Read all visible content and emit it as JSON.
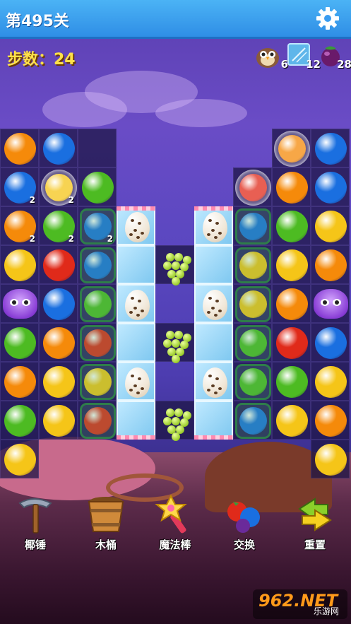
{
  "header": {
    "level_title": "第495关",
    "settings_icon": "gear-icon"
  },
  "moves": {
    "label": "步数：24"
  },
  "goals": [
    {
      "icon": "owl-monster-icon",
      "count": "6"
    },
    {
      "icon": "ice-block-icon",
      "count": "12"
    },
    {
      "icon": "mangosteen-icon",
      "count": "28"
    }
  ],
  "colors": {
    "orange": "#f58a0a",
    "blue": "#1a6fe0",
    "green": "#4dbb22",
    "red": "#e02a1a",
    "yellow": "#f5c518",
    "topbar": "#3a9cf0"
  },
  "board": {
    "rows": [
      [
        "orange",
        "blue",
        "empty",
        "void",
        "void",
        "void",
        "void",
        "bubble-orange",
        "blue"
      ],
      [
        "blue:2",
        "bubble-yellow:2",
        "green",
        "void",
        "void",
        "void",
        "bubble-red",
        "orange",
        "blue"
      ],
      [
        "orange:2",
        "green:2",
        "cage-blue:2",
        "ice-egg",
        "void",
        "ice-egg",
        "cage-blue",
        "green",
        "yellow"
      ],
      [
        "yellow",
        "red",
        "cage-blue",
        "ice",
        "grape",
        "ice",
        "cage-yellow",
        "yellow",
        "orange"
      ],
      [
        "monster",
        "blue",
        "cage-green",
        "ice-egg",
        "void",
        "ice-egg",
        "cage-yellow",
        "orange",
        "monster"
      ],
      [
        "green",
        "orange",
        "cage-red",
        "ice",
        "grape",
        "ice",
        "cage-green",
        "red",
        "blue"
      ],
      [
        "orange",
        "yellow",
        "cage-yellow",
        "ice-egg",
        "void",
        "ice-egg",
        "cage-green",
        "green",
        "yellow"
      ],
      [
        "green",
        "yellow",
        "cage-red",
        "ice",
        "grape",
        "ice",
        "cage-blue",
        "yellow",
        "orange"
      ],
      [
        "yellow",
        "void",
        "void",
        "void",
        "void",
        "void",
        "void",
        "void",
        "yellow"
      ]
    ]
  },
  "tools": [
    {
      "label": "椰锤",
      "icon": "hammer-icon"
    },
    {
      "label": "木桶",
      "icon": "bucket-icon"
    },
    {
      "label": "魔法棒",
      "icon": "magic-wand-icon"
    },
    {
      "label": "交换",
      "icon": "swap-fruits-icon"
    },
    {
      "label": "重置",
      "icon": "reset-arrows-icon"
    }
  ],
  "watermark": {
    "brand": "962.NET",
    "site": "乐游网"
  }
}
